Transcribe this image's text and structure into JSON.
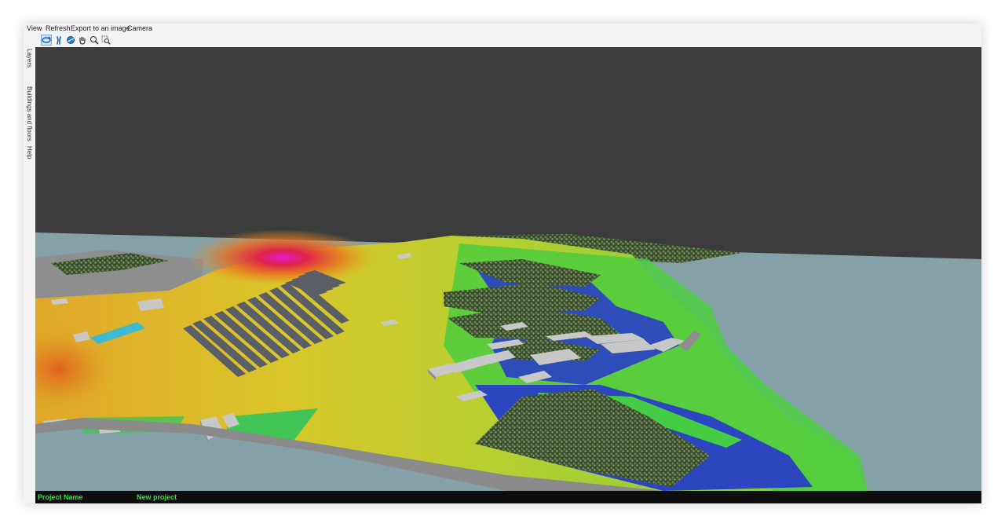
{
  "menu": {
    "items": [
      "View",
      "Refresh",
      "Export to an image",
      "Camera"
    ]
  },
  "toolbar": {
    "tools": [
      "rotate-view-icon",
      "walk-icon",
      "orbit-icon",
      "pan-hand-icon",
      "zoom-icon",
      "zoom-window-icon"
    ],
    "active": "rotate-view-icon"
  },
  "side_tabs": [
    "Layers",
    "Buildings and floors",
    "Help"
  ],
  "status": {
    "project_label": "Project Name",
    "project_value": "New project"
  },
  "colors": {
    "sky": "#3c3c3c",
    "water": "#85a1a8",
    "status_text": "#35e23a",
    "heat_high": "#d81a8c",
    "heat_medium": "#e0d21f",
    "heat_low": "#3ccf4a",
    "heat_min": "#2b3fbf"
  }
}
